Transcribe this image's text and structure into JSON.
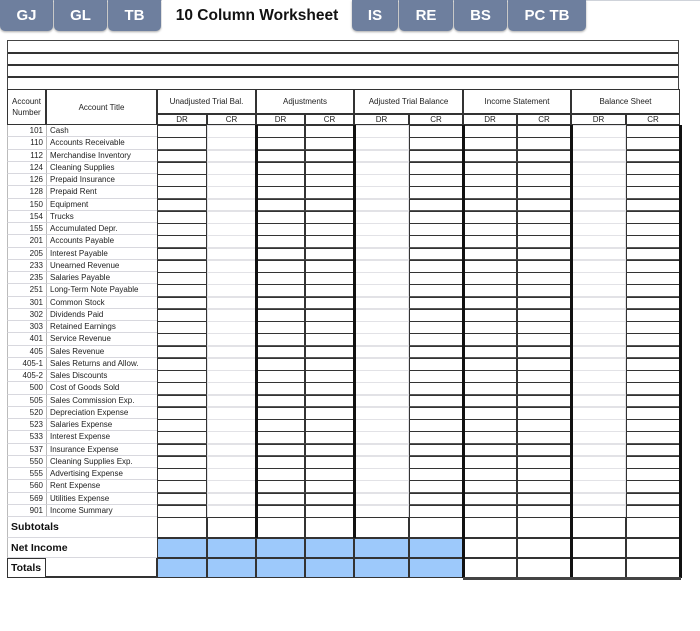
{
  "tabs": [
    {
      "label": "GJ",
      "active": false
    },
    {
      "label": "GL",
      "active": false
    },
    {
      "label": "TB",
      "active": false
    },
    {
      "label": "10 Column Worksheet",
      "active": true
    },
    {
      "label": "IS",
      "active": false
    },
    {
      "label": "RE",
      "active": false
    },
    {
      "label": "BS",
      "active": false
    },
    {
      "label": "PC TB",
      "active": false
    }
  ],
  "worksheet": {
    "header": {
      "account_number": "Account Number",
      "account_title": "Account Title",
      "groups": [
        {
          "label": "Unadjusted Trial Bal.",
          "dr": "DR",
          "cr": "CR"
        },
        {
          "label": "Adjustments",
          "dr": "DR",
          "cr": "CR"
        },
        {
          "label": "Adjusted Trial Balance",
          "dr": "DR",
          "cr": "CR"
        },
        {
          "label": "Income Statement",
          "dr": "DR",
          "cr": "CR"
        },
        {
          "label": "Balance Sheet",
          "dr": "DR",
          "cr": "CR"
        }
      ]
    },
    "accounts": [
      {
        "number": "101",
        "title": "Cash"
      },
      {
        "number": "110",
        "title": "Accounts Receivable"
      },
      {
        "number": "112",
        "title": "Merchandise Inventory"
      },
      {
        "number": "124",
        "title": "Cleaning Supplies"
      },
      {
        "number": "126",
        "title": "Prepaid Insurance"
      },
      {
        "number": "128",
        "title": "Prepaid Rent"
      },
      {
        "number": "150",
        "title": "Equipment"
      },
      {
        "number": "154",
        "title": "Trucks"
      },
      {
        "number": "155",
        "title": "Accumulated Depr."
      },
      {
        "number": "201",
        "title": "Accounts Payable"
      },
      {
        "number": "205",
        "title": "Interest Payable"
      },
      {
        "number": "233",
        "title": "Unearned Revenue"
      },
      {
        "number": "235",
        "title": "Salaries Payable"
      },
      {
        "number": "251",
        "title": "Long-Term Note Payable"
      },
      {
        "number": "301",
        "title": "Common Stock"
      },
      {
        "number": "302",
        "title": "Dividends Paid"
      },
      {
        "number": "303",
        "title": "Retained Earnings"
      },
      {
        "number": "401",
        "title": "Service Revenue"
      },
      {
        "number": "405",
        "title": "Sales Revenue"
      },
      {
        "number": "405-1",
        "title": "Sales Returns and Allow."
      },
      {
        "number": "405-2",
        "title": "Sales Discounts"
      },
      {
        "number": "500",
        "title": "Cost of Goods Sold"
      },
      {
        "number": "505",
        "title": "Sales Commission Exp."
      },
      {
        "number": "520",
        "title": "Depreciation Expense"
      },
      {
        "number": "523",
        "title": "Salaries Expense"
      },
      {
        "number": "533",
        "title": "Interest Expense"
      },
      {
        "number": "537",
        "title": "Insurance Expense"
      },
      {
        "number": "550",
        "title": "Cleaning Supplies Exp."
      },
      {
        "number": "555",
        "title": "Advertising Expense"
      },
      {
        "number": "560",
        "title": "Rent Expense"
      },
      {
        "number": "569",
        "title": "Utilities Expense"
      },
      {
        "number": "901",
        "title": "Income Summary"
      }
    ],
    "summary_rows": [
      {
        "label": "Subtotals"
      },
      {
        "label": "Net Income"
      },
      {
        "label": "Totals"
      }
    ],
    "colors": {
      "tab_bg": "#6e7f9e",
      "highlight_blue": "#9dc9fb"
    }
  }
}
